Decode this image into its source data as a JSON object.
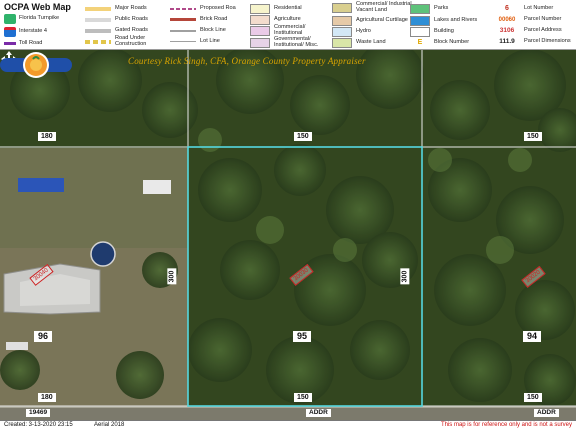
{
  "legend": {
    "title": "OCPA Web Map",
    "items": [
      {
        "key": "florida_turnpike",
        "label": "Florida Turnpike",
        "color": "#2fb36b"
      },
      {
        "key": "interstate_4",
        "label": "Interstate 4",
        "color": "#1e6fd1"
      },
      {
        "key": "toll_road",
        "label": "Toll Road",
        "color": "#7a2ba8"
      },
      {
        "key": "major_roads",
        "label": "Major Roads",
        "color": "#f3d27a"
      },
      {
        "key": "public_roads",
        "label": "Public Roads",
        "color": "#d9d9d9"
      },
      {
        "key": "gated_roads",
        "label": "Gated Roads",
        "color": "#bdbdbd"
      },
      {
        "key": "road_under_construction",
        "label": "Road Under Construction",
        "color": "#e2c64a"
      },
      {
        "key": "proposed_road",
        "label": "Proposed Roa",
        "color": "#b04a8a"
      },
      {
        "key": "brick_road",
        "label": "Brick Road",
        "color": "#b5463a"
      },
      {
        "key": "block_line",
        "label": "Block Line",
        "color": "#a0a0a0"
      },
      {
        "key": "lot_line",
        "label": "Lot Line",
        "color": "#a0a0a0"
      },
      {
        "key": "residential",
        "label": "Residential",
        "color": "#f6f4cc"
      },
      {
        "key": "agriculture",
        "label": "Agriculture",
        "color": "#f2dccd"
      },
      {
        "key": "commercial_institutional",
        "label": "Commercial/ Institutional",
        "color": "#eacbe8"
      },
      {
        "key": "governmental_institutional_misc",
        "label": "Governmental/ Institutional/ Misc.",
        "color": "#e7d3e8"
      },
      {
        "key": "commercial_industrial_vacant",
        "label": "Commercial/ Industrial Vacant Land",
        "color": "#d9cf8f"
      },
      {
        "key": "agricultural_curtilage",
        "label": "Agricultural Curtilage",
        "color": "#e6caa8"
      },
      {
        "key": "hydro",
        "label": "Hydro",
        "color": "#d3e8f6"
      },
      {
        "key": "waste_land",
        "label": "Waste Land",
        "color": "#d9e6a8"
      },
      {
        "key": "parks",
        "label": "Parks",
        "color": "#5ec27a"
      },
      {
        "key": "lakes_and_rivers",
        "label": "Lakes and Rivers",
        "color": "#2f8fd6"
      },
      {
        "key": "building",
        "label": "Building",
        "color": "#ffffff"
      },
      {
        "key": "block_number",
        "label": "Block Number",
        "sample": "E",
        "color": "#e0a800"
      },
      {
        "key": "lot_number",
        "label": "Lot Number",
        "sample": "6",
        "color": "#c03020"
      },
      {
        "key": "parcel_number",
        "label": "Parcel Number",
        "sample": "00060",
        "color": "#e06010"
      },
      {
        "key": "parcel_address",
        "label": "Parcel Address",
        "sample": "3106",
        "color": "#cc3333"
      },
      {
        "key": "parcel_dimensions",
        "label": "Parcel Dimensions",
        "sample": "111.9",
        "color": "#222222"
      }
    ]
  },
  "map": {
    "credit": "Courtesy Rick Singh, CFA, Orange County Property Appraiser",
    "dimensions": {
      "top_left": "180",
      "top_mid": "150",
      "top_right": "150",
      "side_left": "300",
      "side_right": "300",
      "bottom_left": "180",
      "bottom_mid": "150",
      "bottom_right": "150"
    },
    "lots": {
      "left": "96",
      "center": "95",
      "right": "94"
    },
    "addresses": {
      "left": "30040",
      "center": "30030",
      "right": "30020"
    },
    "roads": {
      "left": "19469",
      "center": "ADDR",
      "right": "ADDR"
    },
    "colors": {
      "selected_parcel": "#55d8e0",
      "lot_lines": "#e9e9e9",
      "address": "#cc2222"
    }
  },
  "footer": {
    "created": "Created: 3-13-2020 23:15",
    "aerial": "Aerial 2018",
    "disclaimer": "This map is for reference only and is not a survey"
  }
}
